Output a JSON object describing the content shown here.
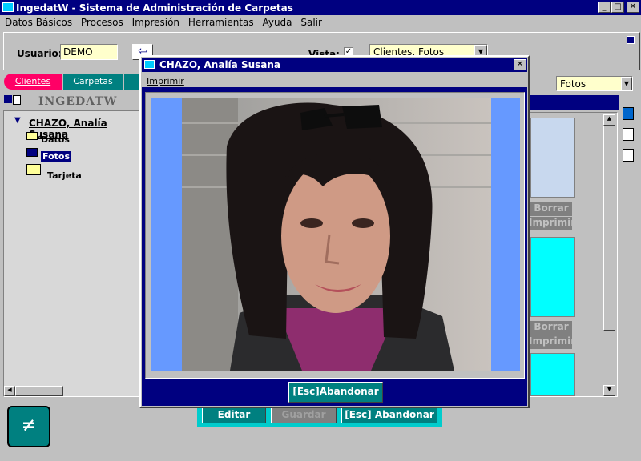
{
  "window": {
    "title": "IngedatW - Sistema de Administración de Carpetas"
  },
  "menu": [
    "Datos Básicos",
    "Procesos",
    "Impresión",
    "Herramientas",
    "Ayuda",
    "Salir"
  ],
  "header": {
    "user_label": "Usuario:",
    "user_value": "DEMO",
    "vista_label": "Vista:",
    "vista_value": "Clientes, Fotos"
  },
  "tabs": [
    "Clientes",
    "Carpetas",
    ""
  ],
  "logo": "INGEDATW",
  "tree": {
    "root": "CHAZO, Analía Susana",
    "items": [
      "Datos",
      "Fotos",
      "Tarjeta"
    ]
  },
  "right": {
    "view_select": "Fotos",
    "borrar": "Borrar",
    "imprimir": "Imprimir"
  },
  "bottom": {
    "edit": "Editar",
    "save": "Guardar",
    "cancel": "[Esc] Abandonar"
  },
  "dialog": {
    "title": "CHAZO, Analía Susana",
    "menu_item": "Imprimir",
    "close_button": "[Esc]Abandonar"
  },
  "colors": {
    "title_bar": "#000080",
    "panel": "#c0c0c0",
    "photo_border": "#6699ff",
    "accent": "#00ffff"
  }
}
